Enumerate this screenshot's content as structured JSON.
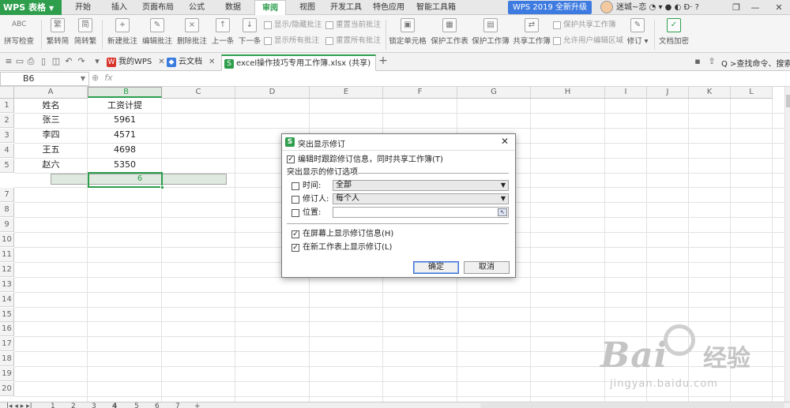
{
  "app": {
    "name": "WPS 表格"
  },
  "menu_tabs": [
    "开始",
    "插入",
    "页面布局",
    "公式",
    "数据",
    "审阅",
    "视图",
    "开发工具",
    "特色应用",
    "智能工具箱"
  ],
  "active_tab": "审阅",
  "upgrade": "WPS 2019 全新升级",
  "user": {
    "name": "迷城~恋"
  },
  "window_controls": {
    "minimize": "—",
    "restore": "❐",
    "close": "✕",
    "help": "?"
  },
  "ribbon": {
    "spellcheck": "拼写检查",
    "spell_ic": "ABC",
    "trad_to_simp": "繁转简",
    "simp_to_trad": "简转繁",
    "new_comment": "新建批注",
    "edit_comment": "编辑批注",
    "delete_comment": "删除批注",
    "prev": "上一条",
    "next": "下一条",
    "show_hide_comment": "显示/隐藏批注",
    "show_all_comments": "显示所有批注",
    "reset_current": "重置当前批注",
    "reset_all": "重置所有批注",
    "lock_cell": "锁定单元格",
    "protect_sheet": "保护工作表",
    "protect_workbook": "保护工作簿",
    "share_workbook": "共享工作簿",
    "protect_share": "保护共享工作簿",
    "allow_edit_ranges": "允许用户编辑区域",
    "track_changes": "修订",
    "encrypt": "文档加密"
  },
  "file_tabs": [
    {
      "label": "我的WPS",
      "icon": "W"
    },
    {
      "label": "云文档",
      "icon": "◆"
    },
    {
      "label": "excel操作技巧专用工作簿.xlsx (共享)",
      "icon": "S"
    }
  ],
  "new_tab": "+",
  "search_cmd": "Q >查找命令、搜索..",
  "namebox": "B6",
  "fx": "fx",
  "columns": [
    "A",
    "B",
    "C",
    "D",
    "E",
    "F",
    "G",
    "H",
    "I",
    "J",
    "K",
    "L"
  ],
  "rows": [
    "1",
    "2",
    "3",
    "4",
    "5",
    "6",
    "7",
    "8",
    "9",
    "10",
    "11",
    "12",
    "13",
    "14",
    "15",
    "16",
    "17",
    "18",
    "19",
    "20"
  ],
  "cells": {
    "A1": "姓名",
    "B1": "工资计提",
    "A2": "张三",
    "B2": "5961",
    "A3": "李四",
    "B3": "4571",
    "A4": "王五",
    "B4": "4698",
    "A5": "赵六",
    "B5": "5350"
  },
  "sheet_tabs": [
    "1",
    "2",
    "3",
    "4",
    "5",
    "6",
    "7",
    "+"
  ],
  "dialog": {
    "title": "突出显示修订",
    "logo": "S",
    "close": "✕",
    "track_while_editing": "编辑时跟踪修订信息，同时共享工作簿(T)",
    "group_label": "突出显示的修订选项",
    "when_label": "时间:",
    "when_value": "全部",
    "who_label": "修订人:",
    "who_value": "每个人",
    "where_label": "位置:",
    "on_screen": "在屏幕上显示修订信息(H)",
    "new_sheet": "在新工作表上显示修订(L)",
    "ok": "确定",
    "cancel": "取消"
  },
  "watermark": {
    "brand": "Bai",
    "brand2": "经验",
    "url": "jingyan.baidu.com"
  }
}
